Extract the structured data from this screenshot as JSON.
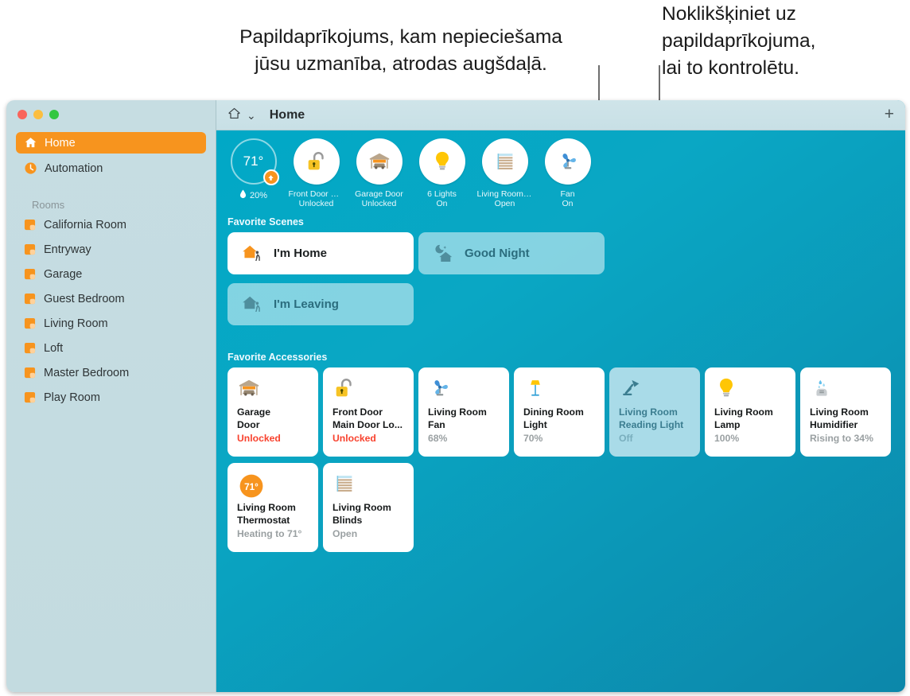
{
  "callouts": {
    "left": "Papildaprīkojums, kam nepieciešama\njūsu uzmanība, atrodas augšdaļā.",
    "right": "Noklikšķiniet uz\npapildaprīkojuma,\nlai to kontrolētu."
  },
  "window": {
    "traffic_lights": [
      "close",
      "minimize",
      "zoom"
    ]
  },
  "toolbar": {
    "home_icon": "house-icon",
    "chevron": "⌄",
    "title": "Home",
    "add_label": "+"
  },
  "sidebar": {
    "nav": [
      {
        "label": "Home",
        "icon": "house-icon",
        "selected": true
      },
      {
        "label": "Automation",
        "icon": "clock-icon",
        "selected": false
      }
    ],
    "section_label": "Rooms",
    "rooms": [
      {
        "label": "California Room",
        "icon": "room-icon"
      },
      {
        "label": "Entryway",
        "icon": "room-icon"
      },
      {
        "label": "Garage",
        "icon": "room-icon"
      },
      {
        "label": "Guest Bedroom",
        "icon": "room-icon"
      },
      {
        "label": "Living Room",
        "icon": "room-icon"
      },
      {
        "label": "Loft",
        "icon": "room-icon"
      },
      {
        "label": "Master Bedroom",
        "icon": "room-icon"
      },
      {
        "label": "Play Room",
        "icon": "room-icon"
      }
    ]
  },
  "status": {
    "climate": {
      "temperature": "71°",
      "humidity": "20%",
      "trend_icon": "arrow-up-icon",
      "humidity_icon": "droplet-icon"
    },
    "items": [
      {
        "icon": "unlocked-padlock-icon",
        "label": "Front Door Mai...",
        "state": "Unlocked"
      },
      {
        "icon": "garage-icon",
        "label": "Garage Door",
        "state": "Unlocked"
      },
      {
        "icon": "lightbulb-icon",
        "label": "6 Lights",
        "state": "On"
      },
      {
        "icon": "blinds-icon",
        "label": "Living Room Bl...",
        "state": "Open"
      },
      {
        "icon": "fan-icon",
        "label": "Fan",
        "state": "On"
      }
    ]
  },
  "scenes": {
    "heading": "Favorite Scenes",
    "items": [
      {
        "name": "I'm Home",
        "icon": "house-person-icon",
        "active": true
      },
      {
        "name": "Good Night",
        "icon": "moon-house-icon",
        "active": false
      },
      {
        "name": "I'm Leaving",
        "icon": "house-person-icon",
        "active": false
      }
    ]
  },
  "accessories": {
    "heading": "Favorite Accessories",
    "items": [
      {
        "icon": "garage-icon",
        "title": "Garage\nDoor",
        "status": "Unlocked",
        "status_kind": "red",
        "off": false
      },
      {
        "icon": "unlocked-padlock-icon",
        "title": "Front Door\nMain Door Lo...",
        "status": "Unlocked",
        "status_kind": "red",
        "off": false
      },
      {
        "icon": "fan-icon",
        "title": "Living Room\nFan",
        "status": "68%",
        "status_kind": "grey",
        "off": false
      },
      {
        "icon": "floor-lamp-icon",
        "title": "Dining Room\nLight",
        "status": "70%",
        "status_kind": "grey",
        "off": false
      },
      {
        "icon": "desk-lamp-icon",
        "title": "Living Room\nReading Light",
        "status": "Off",
        "status_kind": "dim",
        "off": true
      },
      {
        "icon": "lightbulb-icon",
        "title": "Living Room\nLamp",
        "status": "100%",
        "status_kind": "grey",
        "off": false
      },
      {
        "icon": "humidifier-icon",
        "title": "Living Room\nHumidifier",
        "status": "Rising to 34%",
        "status_kind": "grey",
        "off": false
      },
      {
        "icon": "thermostat-icon",
        "title": "Living Room\nThermostat",
        "status": "Heating to 71°",
        "status_kind": "grey",
        "off": false,
        "badge": "71°"
      },
      {
        "icon": "blinds-icon",
        "title": "Living Room\nBlinds",
        "status": "Open",
        "status_kind": "grey",
        "off": false
      }
    ]
  },
  "colors": {
    "accent_orange": "#F7941E",
    "alert_red": "#F8422E",
    "pane_cyan": "#00A8C6",
    "sidebar_blue": "#C6DDE2",
    "tile_off_blue": "#A9DBE8"
  }
}
